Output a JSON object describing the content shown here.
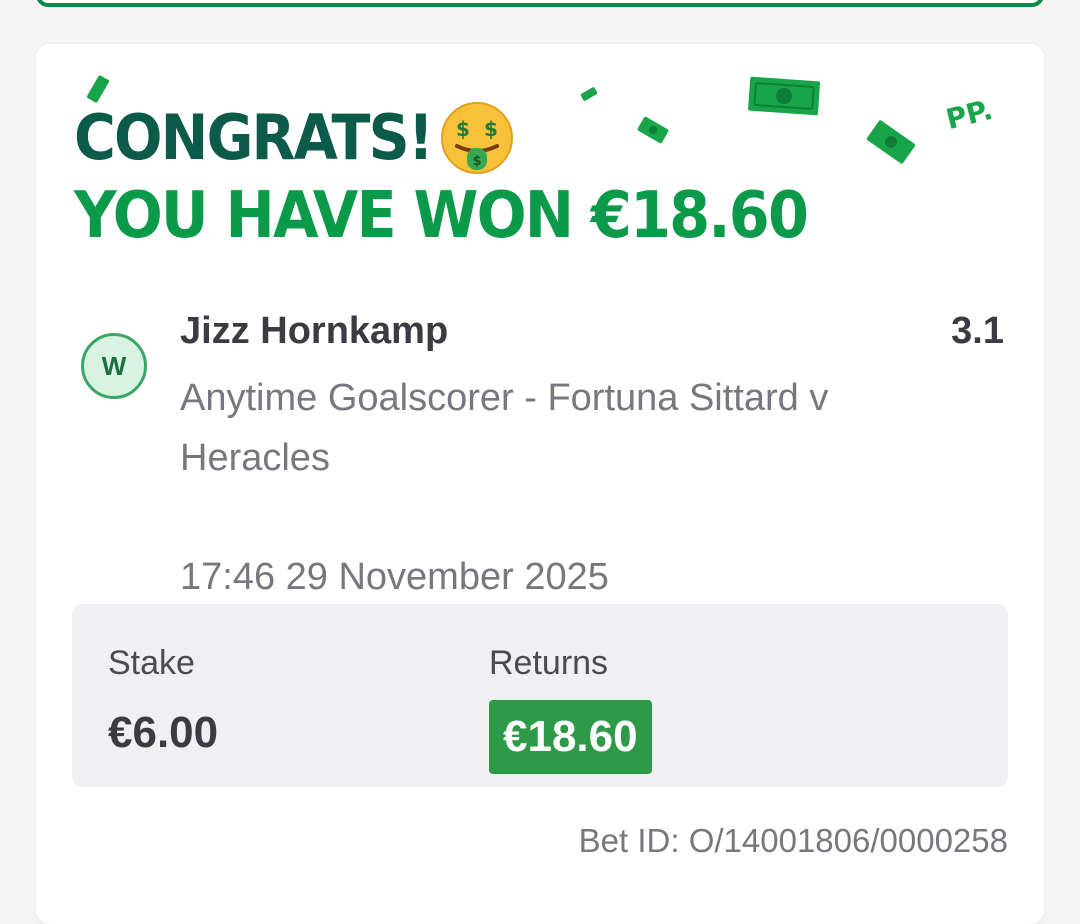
{
  "banner": {
    "congrats": "CONGRATS!",
    "won_text": "YOU HAVE WON €18.60",
    "logo": "PP.",
    "emoji": "money-mouth-face-icon",
    "decor_icon": "banknote-icon"
  },
  "selection": {
    "status": "W",
    "runner": "Jizz Hornkamp",
    "odds": "3.1",
    "market": "Anytime Goalscorer - Fortuna Sittard v Heracles",
    "datetime": "17:46 29 November 2025"
  },
  "summary": {
    "stake_label": "Stake",
    "stake_value": "€6.00",
    "returns_label": "Returns",
    "returns_value": "€18.60"
  },
  "bet_id": "Bet ID: O/14001806/0000258",
  "colors": {
    "brand_dark": "#0b5a4a",
    "brand_green": "#0b9a4a",
    "returns_bg": "#2e9a48",
    "text_dark": "#3b3b44",
    "text_muted": "#77777f"
  }
}
